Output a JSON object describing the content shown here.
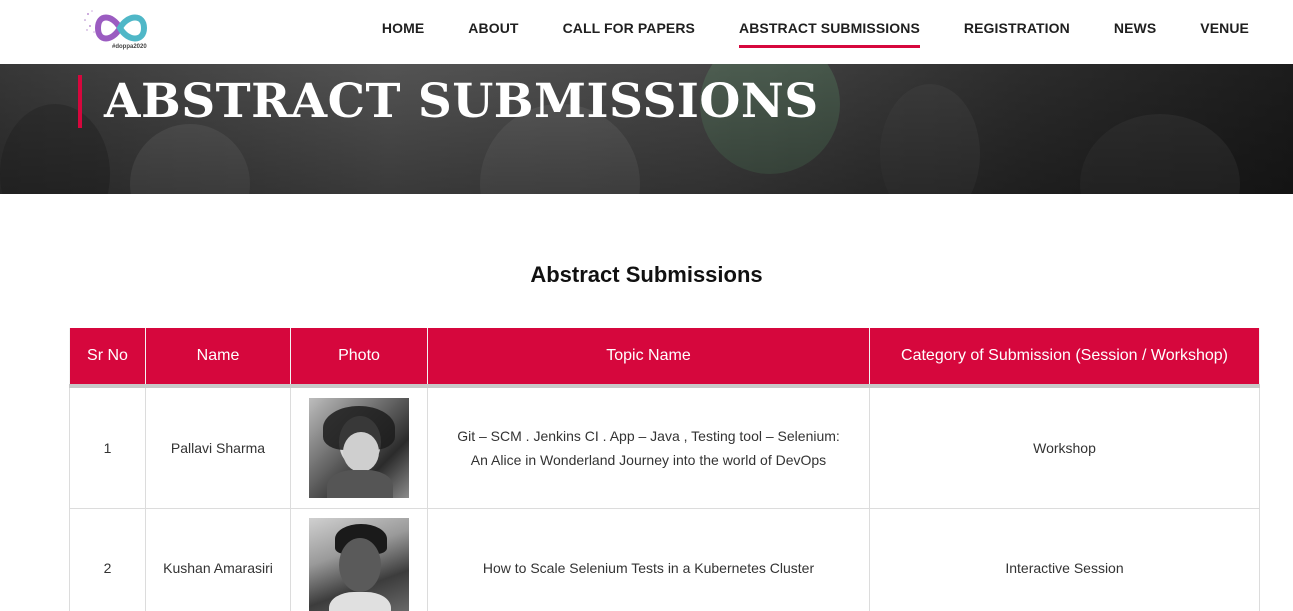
{
  "header": {
    "logo_tag": "#doppa2020",
    "nav": [
      {
        "label": "HOME",
        "active": false
      },
      {
        "label": "ABOUT",
        "active": false
      },
      {
        "label": "CALL FOR PAPERS",
        "active": false
      },
      {
        "label": "ABSTRACT SUBMISSIONS",
        "active": true
      },
      {
        "label": "REGISTRATION",
        "active": false
      },
      {
        "label": "NEWS",
        "active": false
      },
      {
        "label": "VENUE",
        "active": false
      }
    ]
  },
  "banner": {
    "title": "ABSTRACT SUBMISSIONS"
  },
  "main": {
    "heading": "Abstract Submissions",
    "table": {
      "headers": [
        "Sr No",
        "Name",
        "Photo",
        "Topic Name",
        "Category of Submission (Session / Workshop)"
      ],
      "rows": [
        {
          "sr_no": "1",
          "name": "Pallavi Sharma",
          "topic_line1": "Git – SCM . Jenkins CI . App – Java , Testing tool – Selenium:",
          "topic_line2": "An Alice in Wonderland Journey into the world of DevOps",
          "category": "Workshop"
        },
        {
          "sr_no": "2",
          "name": "Kushan Amarasiri",
          "topic_line1": "How to Scale Selenium Tests in a Kubernetes Cluster",
          "topic_line2": "",
          "category": "Interactive Session"
        }
      ]
    }
  },
  "colors": {
    "accent": "#d6073d",
    "header_bg": "#ffffff",
    "table_header_text": "#ffffff"
  }
}
